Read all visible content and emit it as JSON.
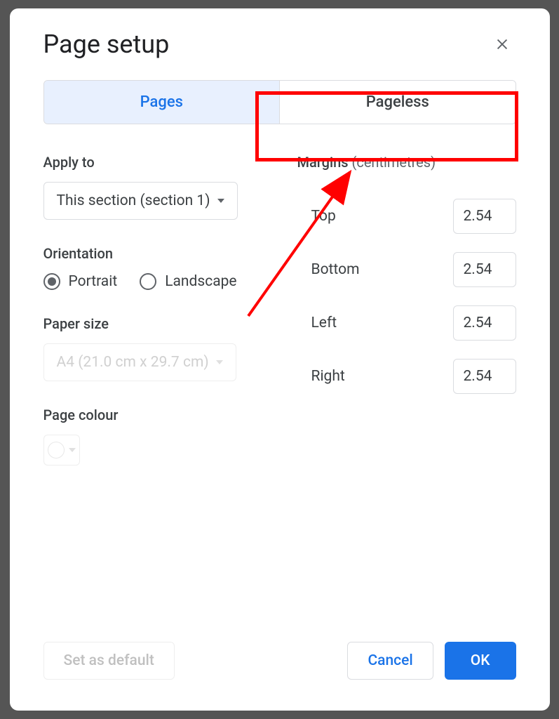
{
  "dialog": {
    "title": "Page setup"
  },
  "tabs": {
    "pages": "Pages",
    "pageless": "Pageless"
  },
  "applyTo": {
    "label": "Apply to",
    "value": "This section (section 1)"
  },
  "orientation": {
    "label": "Orientation",
    "portrait": "Portrait",
    "landscape": "Landscape"
  },
  "paperSize": {
    "label": "Paper size",
    "value": "A4 (21.0 cm x 29.7 cm)"
  },
  "pageColour": {
    "label": "Page colour"
  },
  "margins": {
    "label": "Margins",
    "unit": "(centimetres)",
    "top": {
      "label": "Top",
      "value": "2.54"
    },
    "bottom": {
      "label": "Bottom",
      "value": "2.54"
    },
    "left": {
      "label": "Left",
      "value": "2.54"
    },
    "right": {
      "label": "Right",
      "value": "2.54"
    }
  },
  "footer": {
    "setDefault": "Set as default",
    "cancel": "Cancel",
    "ok": "OK"
  }
}
